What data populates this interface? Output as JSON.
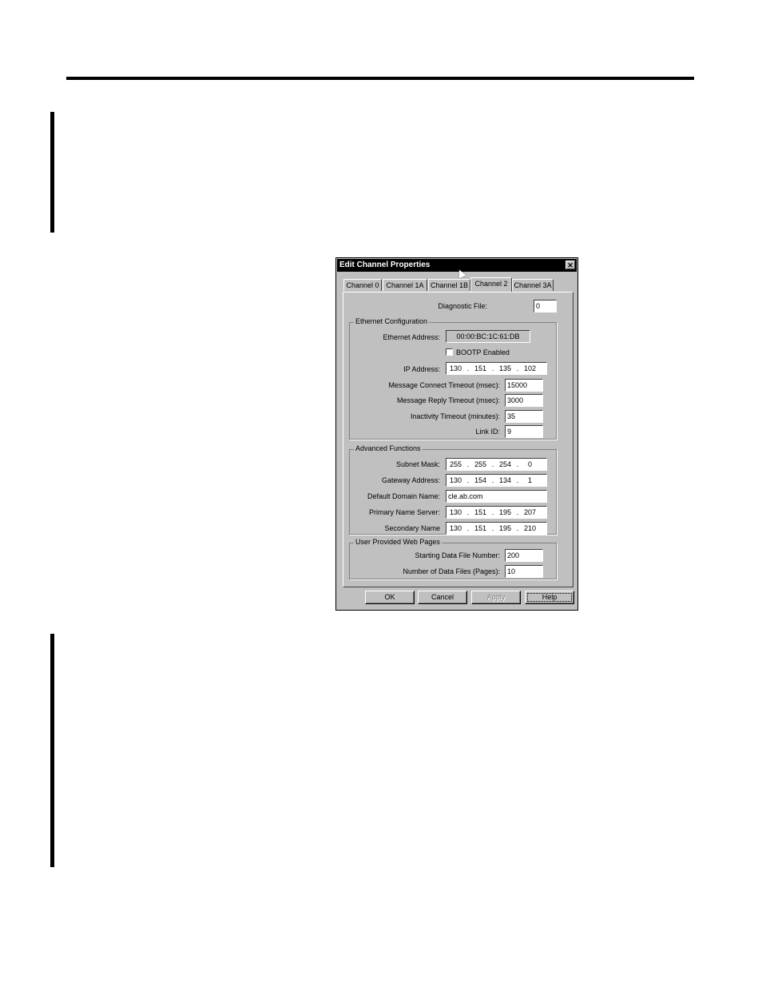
{
  "dialog": {
    "title": "Edit Channel Properties",
    "close_glyph": "✕",
    "tabs": [
      "Channel 0",
      "Channel 1A",
      "Channel 1B",
      "Channel 2",
      "Channel 3A"
    ],
    "active_tab": "Channel 2",
    "diagnostic_file": {
      "label": "Diagnostic File:",
      "value": "0"
    },
    "ethernet": {
      "title": "Ethernet Configuration",
      "address_label": "Ethernet Address:",
      "address_value": "00:00:BC:1C:61:DB",
      "bootp_label": "BOOTP Enabled",
      "bootp_checked": false,
      "ip_label": "IP Address:",
      "ip": [
        "130",
        "151",
        "135",
        "102"
      ],
      "connect_timeout_label": "Message Connect Timeout (msec):",
      "connect_timeout": "15000",
      "reply_timeout_label": "Message Reply Timeout (msec):",
      "reply_timeout": "3000",
      "inactivity_label": "Inactivity Timeout (minutes):",
      "inactivity": "35",
      "link_id_label": "Link ID:",
      "link_id": "9"
    },
    "advanced": {
      "title": "Advanced Functions",
      "subnet_label": "Subnet Mask:",
      "subnet": [
        "255",
        "255",
        "254",
        "0"
      ],
      "gateway_label": "Gateway Address:",
      "gateway": [
        "130",
        "154",
        "134",
        "1"
      ],
      "domain_label": "Default Domain Name:",
      "domain": "cle.ab.com",
      "primary_label": "Primary Name Server:",
      "primary": [
        "130",
        "151",
        "195",
        "207"
      ],
      "secondary_label": "Secondary Name",
      "secondary": [
        "130",
        "151",
        "195",
        "210"
      ]
    },
    "web": {
      "title": "User Provided Web Pages",
      "start_label": "Starting Data File Number:",
      "start": "200",
      "count_label": "Number of Data Files (Pages):",
      "count": "10"
    },
    "buttons": {
      "ok": "OK",
      "cancel": "Cancel",
      "apply": "Apply",
      "help": "Help"
    }
  }
}
